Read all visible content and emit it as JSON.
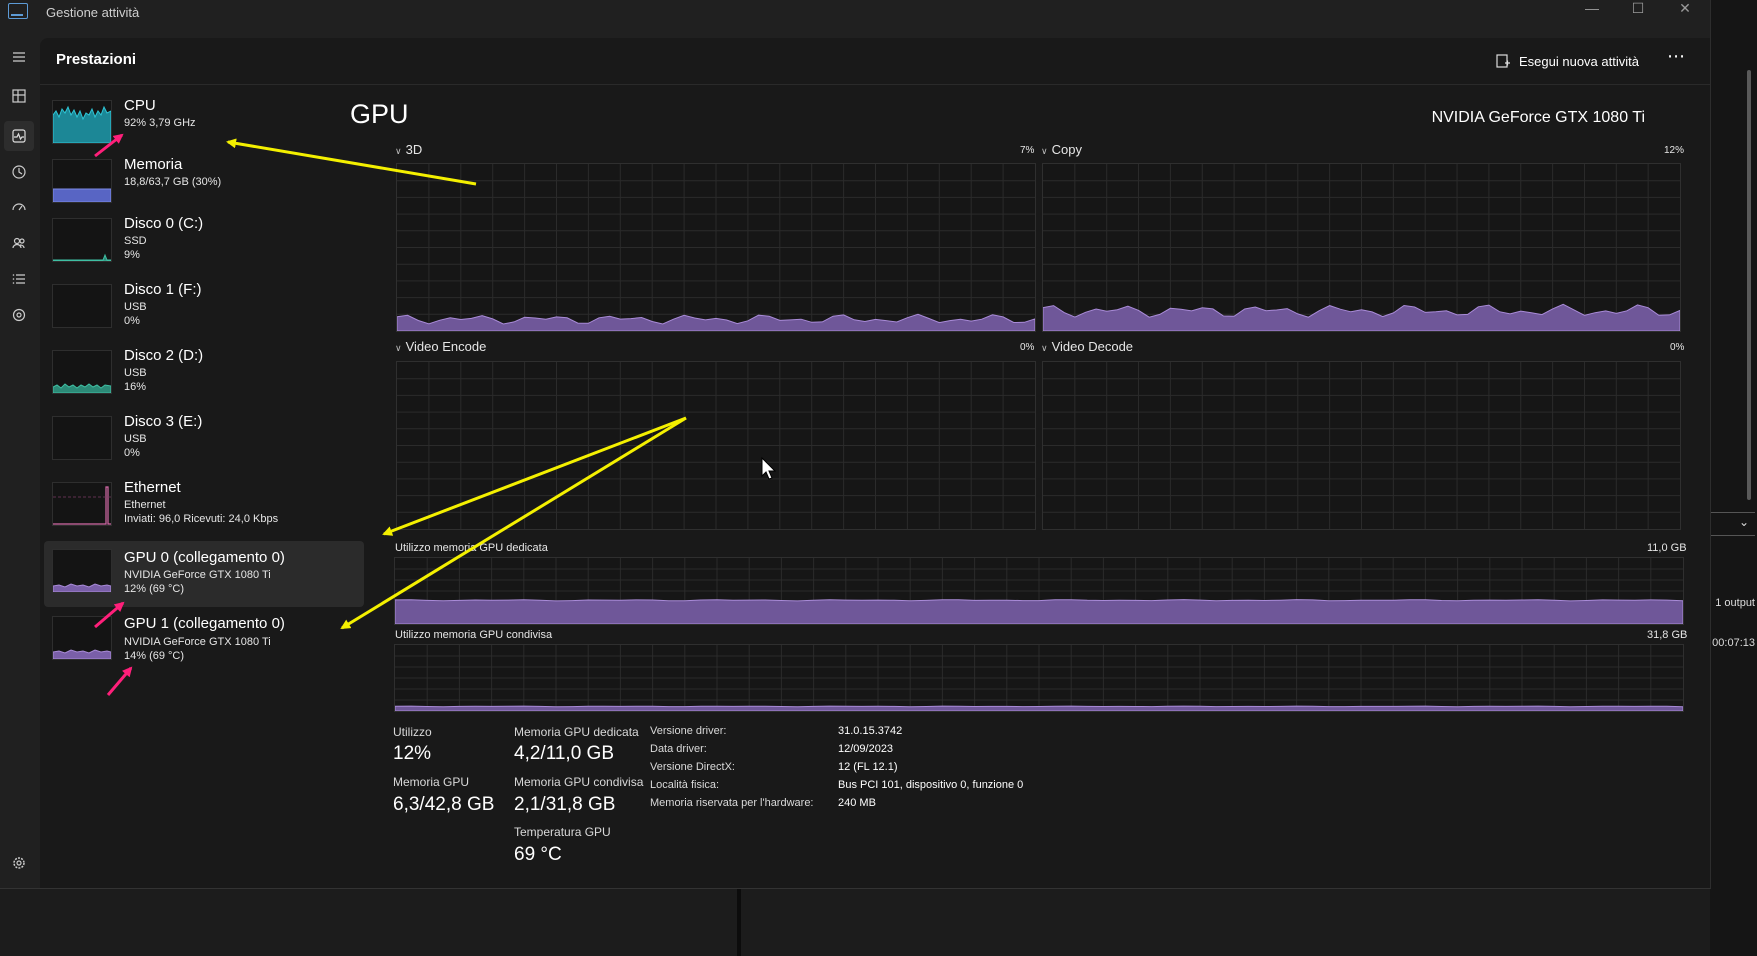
{
  "window": {
    "title": "Gestione attività",
    "controls": [
      "—",
      "☐",
      "✕"
    ]
  },
  "header": {
    "title": "Prestazioni",
    "run_task": "Esegui nuova attività",
    "more": "⋯"
  },
  "sidebar": [
    {
      "name": "CPU",
      "line1": "92% 3,79 GHz",
      "line2": "",
      "line3": ""
    },
    {
      "name": "Memoria",
      "line1": "18,8/63,7 GB (30%)",
      "line2": "",
      "line3": ""
    },
    {
      "name": "Disco 0 (C:)",
      "line1": "SSD",
      "line2": "9%",
      "line3": ""
    },
    {
      "name": "Disco 1 (F:)",
      "line1": "USB",
      "line2": "0%",
      "line3": ""
    },
    {
      "name": "Disco 2 (D:)",
      "line1": "USB",
      "line2": "16%",
      "line3": ""
    },
    {
      "name": "Disco 3 (E:)",
      "line1": "USB",
      "line2": "0%",
      "line3": ""
    },
    {
      "name": "Ethernet",
      "line1": "Ethernet",
      "line2": "Inviati: 96,0 Ricevuti: 24,0 Kbps",
      "line3": ""
    },
    {
      "name": "GPU 0 (collegamento 0)",
      "line1": "NVIDIA GeForce GTX 1080 Ti",
      "line2": "12% (69 °C)",
      "line3": ""
    },
    {
      "name": "GPU 1 (collegamento 0)",
      "line1": "NVIDIA GeForce GTX 1080 Ti",
      "line2": "14% (69 °C)",
      "line3": ""
    }
  ],
  "main": {
    "title": "GPU",
    "model": "NVIDIA GeForce GTX 1080 Ti",
    "engines": [
      {
        "label": "3D",
        "pct": "7%"
      },
      {
        "label": "Copy",
        "pct": "12%"
      },
      {
        "label": "Video Encode",
        "pct": "0%"
      },
      {
        "label": "Video Decode",
        "pct": "0%"
      }
    ],
    "dedicated": {
      "label": "Utilizzo memoria GPU dedicata",
      "max": "11,0 GB"
    },
    "shared": {
      "label": "Utilizzo memoria GPU condivisa",
      "max": "31,8 GB"
    },
    "stats": {
      "util_label": "Utilizzo",
      "util_value": "12%",
      "gpumem_label": "Memoria GPU",
      "gpumem_value": "6,3/42,8 GB",
      "ded_label": "Memoria GPU dedicata",
      "ded_value": "4,2/11,0 GB",
      "sh_label": "Memoria GPU condivisa",
      "sh_value": "2,1/31,8 GB",
      "temp_label": "Temperatura GPU",
      "temp_value": "69 °C"
    },
    "info": [
      {
        "k": "Versione driver:",
        "v": "31.0.15.3742"
      },
      {
        "k": "Data driver:",
        "v": "12/09/2023"
      },
      {
        "k": "Versione DirectX:",
        "v": "12 (FL 12.1)"
      },
      {
        "k": "Località fisica:",
        "v": "Bus PCI 101, dispositivo 0, funzione 0"
      },
      {
        "k": "Memoria riservata per l'hardware:",
        "v": "240 MB"
      }
    ]
  },
  "background": {
    "right_text1": "1 output",
    "right_text2": "00:07:13"
  },
  "colors": {
    "gpu": "#9a7ac5",
    "cpu": "#2aa6b5",
    "memory": "#6f7ed8",
    "disk": "#3aa38e",
    "ethernet": "#d46aa8",
    "arrow_yellow": "#f4f000",
    "arrow_pink": "#ff1f7a"
  }
}
